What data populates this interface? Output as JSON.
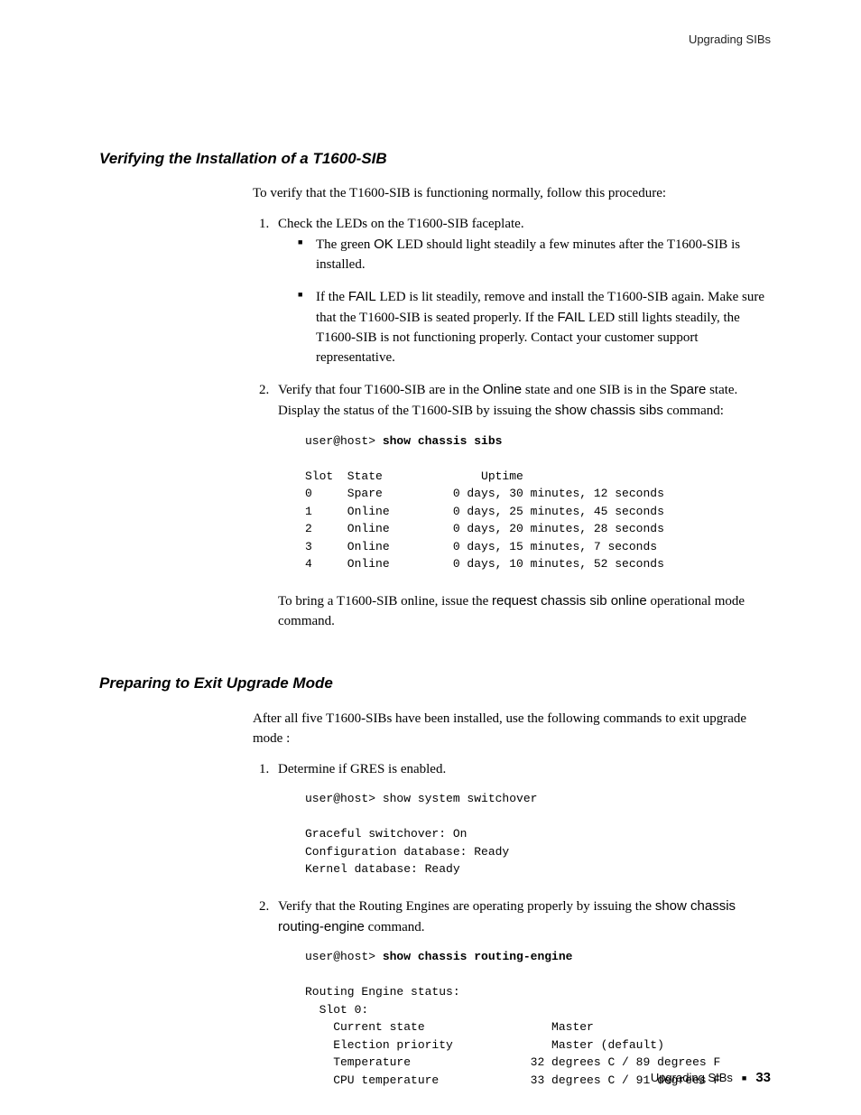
{
  "header": {
    "right": "Upgrading SIBs"
  },
  "section1": {
    "heading": "Verifying the Installation of a T1600-SIB",
    "intro": "To verify that the T1600-SIB is functioning normally, follow this procedure:",
    "step1": "Check the LEDs on the T1600-SIB faceplate.",
    "bullet1_pre": "The green ",
    "bullet1_led": "OK",
    "bullet1_post": " LED should light steadily a few minutes after the T1600-SIB is installed.",
    "bullet2_a": "If the ",
    "bullet2_fail1": "FAIL",
    "bullet2_b": " LED is lit steadily, remove and install the T1600-SIB again. Make sure that the T1600-SIB is seated properly. If the ",
    "bullet2_fail2": "FAIL",
    "bullet2_c": " LED still lights steadily, the T1600-SIB is not functioning properly. Contact your customer support representative.",
    "step2_a": "Verify that four T1600-SIB are in the ",
    "step2_online": "Online",
    "step2_b": " state and one SIB is in the ",
    "step2_spare": "Spare",
    "step2_c": " state. Display the status of the T1600-SIB by issuing the ",
    "step2_cmd": "show chassis sibs",
    "step2_d": " command:",
    "code1_prompt": "user@host> ",
    "code1_cmd": "show chassis sibs",
    "code1_body": "Slot  State              Uptime\n0     Spare          0 days, 30 minutes, 12 seconds\n1     Online         0 days, 25 minutes, 45 seconds\n2     Online         0 days, 20 minutes, 28 seconds\n3     Online         0 days, 15 minutes, 7 seconds\n4     Online         0 days, 10 minutes, 52 seconds",
    "outro_a": "To bring a T1600-SIB online, issue the ",
    "outro_cmd": "request chassis sib online",
    "outro_b": " operational mode command."
  },
  "section2": {
    "heading": "Preparing to Exit Upgrade Mode",
    "intro": "After all five T1600-SIBs have been installed, use the following commands to exit upgrade mode :",
    "step1": "Determine if GRES is enabled.",
    "code1": "user@host> show system switchover\n\nGraceful switchover: On\nConfiguration database: Ready\nKernel database: Ready",
    "step2_a": "Verify that the Routing Engines are operating properly by issuing the ",
    "step2_cmd": "show chassis routing-engine",
    "step2_b": " command.",
    "code2_prompt": "user@host> ",
    "code2_cmd": "show chassis routing-engine",
    "code2_body": "Routing Engine status:\n  Slot 0:\n    Current state                  Master\n    Election priority              Master (default)\n    Temperature                 32 degrees C / 89 degrees F\n    CPU temperature             33 degrees C / 91 degrees F"
  },
  "footer": {
    "label": "Upgrading SIBs",
    "page": "33"
  }
}
